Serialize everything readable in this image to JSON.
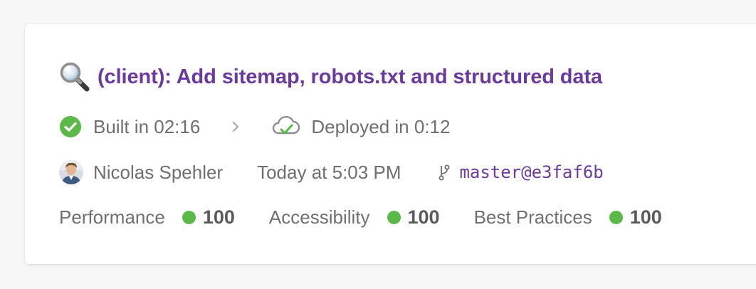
{
  "deploy": {
    "title": "(client): Add sitemap, robots.txt and structured data",
    "title_icon": "magnifying-glass-icon",
    "build_status": "Built in 02:16",
    "deploy_status": "Deployed in 0:12",
    "author": "Nicolas Spehler",
    "time": "Today at 5:03 PM",
    "commit": "master@e3faf6b"
  },
  "metrics": [
    {
      "label": "Performance",
      "score": "100"
    },
    {
      "label": "Accessibility",
      "score": "100"
    },
    {
      "label": "Best Practices",
      "score": "100"
    }
  ],
  "colors": {
    "accent": "#6a3a9e",
    "success": "#5ab947",
    "muted_text": "#6f6f73",
    "background": "#f7f7f8",
    "card": "#ffffff"
  }
}
